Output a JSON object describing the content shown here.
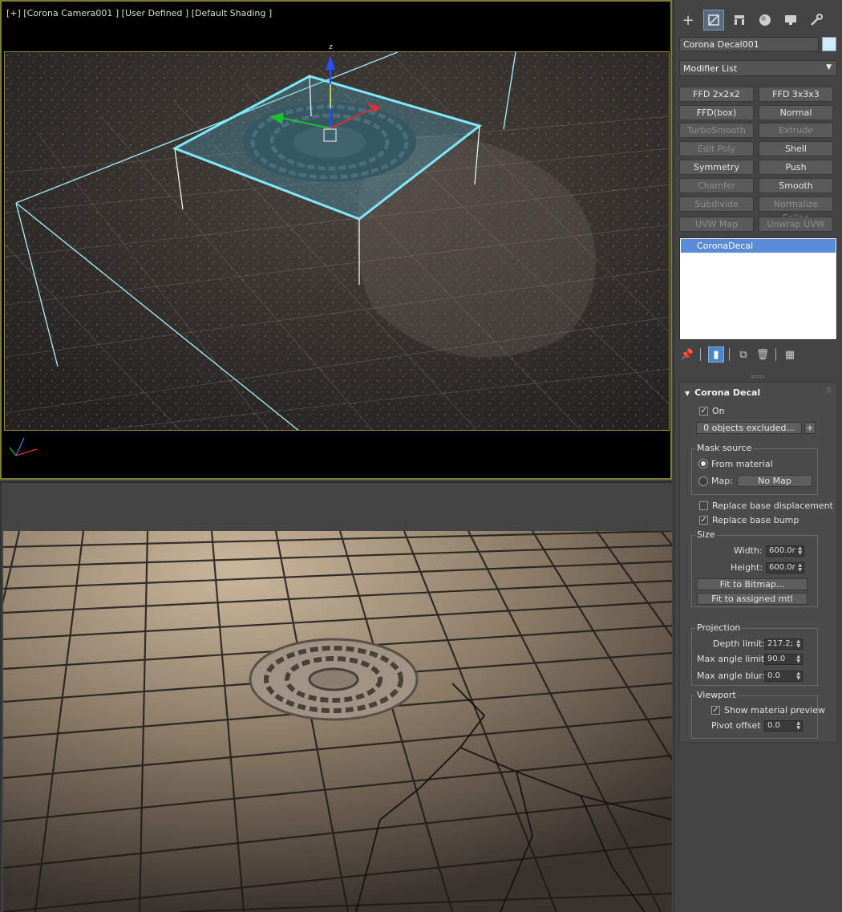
{
  "viewport_top": {
    "label": "[+] [Corona Camera001 ] [User Defined ] [Default Shading ]",
    "gizmo_axis_z": "z"
  },
  "panel": {
    "tabs": [
      "create-icon",
      "modify-icon",
      "hierarchy-icon",
      "motion-icon",
      "display-icon",
      "utilities-icon"
    ],
    "object_name": "Corona Decal001",
    "object_color": "#cfeaff",
    "modifier_list": "Modifier List",
    "modifier_buttons": [
      {
        "label": "FFD 2x2x2",
        "enabled": true
      },
      {
        "label": "FFD 3x3x3",
        "enabled": true
      },
      {
        "label": "FFD(box)",
        "enabled": true
      },
      {
        "label": "Normal",
        "enabled": true
      },
      {
        "label": "TurboSmooth",
        "enabled": false
      },
      {
        "label": "Extrude",
        "enabled": false
      },
      {
        "label": "Edit Poly",
        "enabled": false
      },
      {
        "label": "Shell",
        "enabled": true
      },
      {
        "label": "Symmetry",
        "enabled": true
      },
      {
        "label": "Push",
        "enabled": true
      },
      {
        "label": "Chamfer",
        "enabled": false
      },
      {
        "label": "Smooth",
        "enabled": true
      },
      {
        "label": "Subdivide",
        "enabled": false
      },
      {
        "label": "Normalize Spline",
        "enabled": false
      },
      {
        "label": "UVW Map",
        "enabled": false
      },
      {
        "label": "Unwrap UVW",
        "enabled": false
      }
    ],
    "stack_item": "CoronaDecal",
    "rollout": {
      "title": "Corona Decal",
      "on_label": "On",
      "on_checked": true,
      "excluded_button": "0 objects excluded...",
      "plus_button": "+",
      "mask_source": "Mask source",
      "from_material": "From material",
      "map_label": "Map:",
      "no_map": "No Map",
      "replace_disp": "Replace base displacement",
      "replace_disp_checked": false,
      "replace_bump": "Replace base bump",
      "replace_bump_checked": true,
      "size_group": "Size",
      "width_label": "Width:",
      "width_value": "600.0r",
      "height_label": "Height:",
      "height_value": "600.0r",
      "fit_bitmap": "Fit to Bitmap...",
      "fit_mtl": "Fit to assigned mtl",
      "projection_group": "Projection",
      "depth_label": "Depth limit:",
      "depth_value": "217.2;",
      "max_angle_label": "Max angle limit:",
      "max_angle_value": "90.0",
      "max_blur_label": "Max angle blur:",
      "max_blur_value": "0.0",
      "viewport_group": "Viewport",
      "show_preview": "Show material preview",
      "show_preview_checked": true,
      "pivot_label": "Pivot offset",
      "pivot_value": "0.0"
    }
  },
  "colors": {
    "selection": "#5a8bd6",
    "gizmo": "#7fe8ff",
    "viewport_border": "#8f8a3e"
  }
}
